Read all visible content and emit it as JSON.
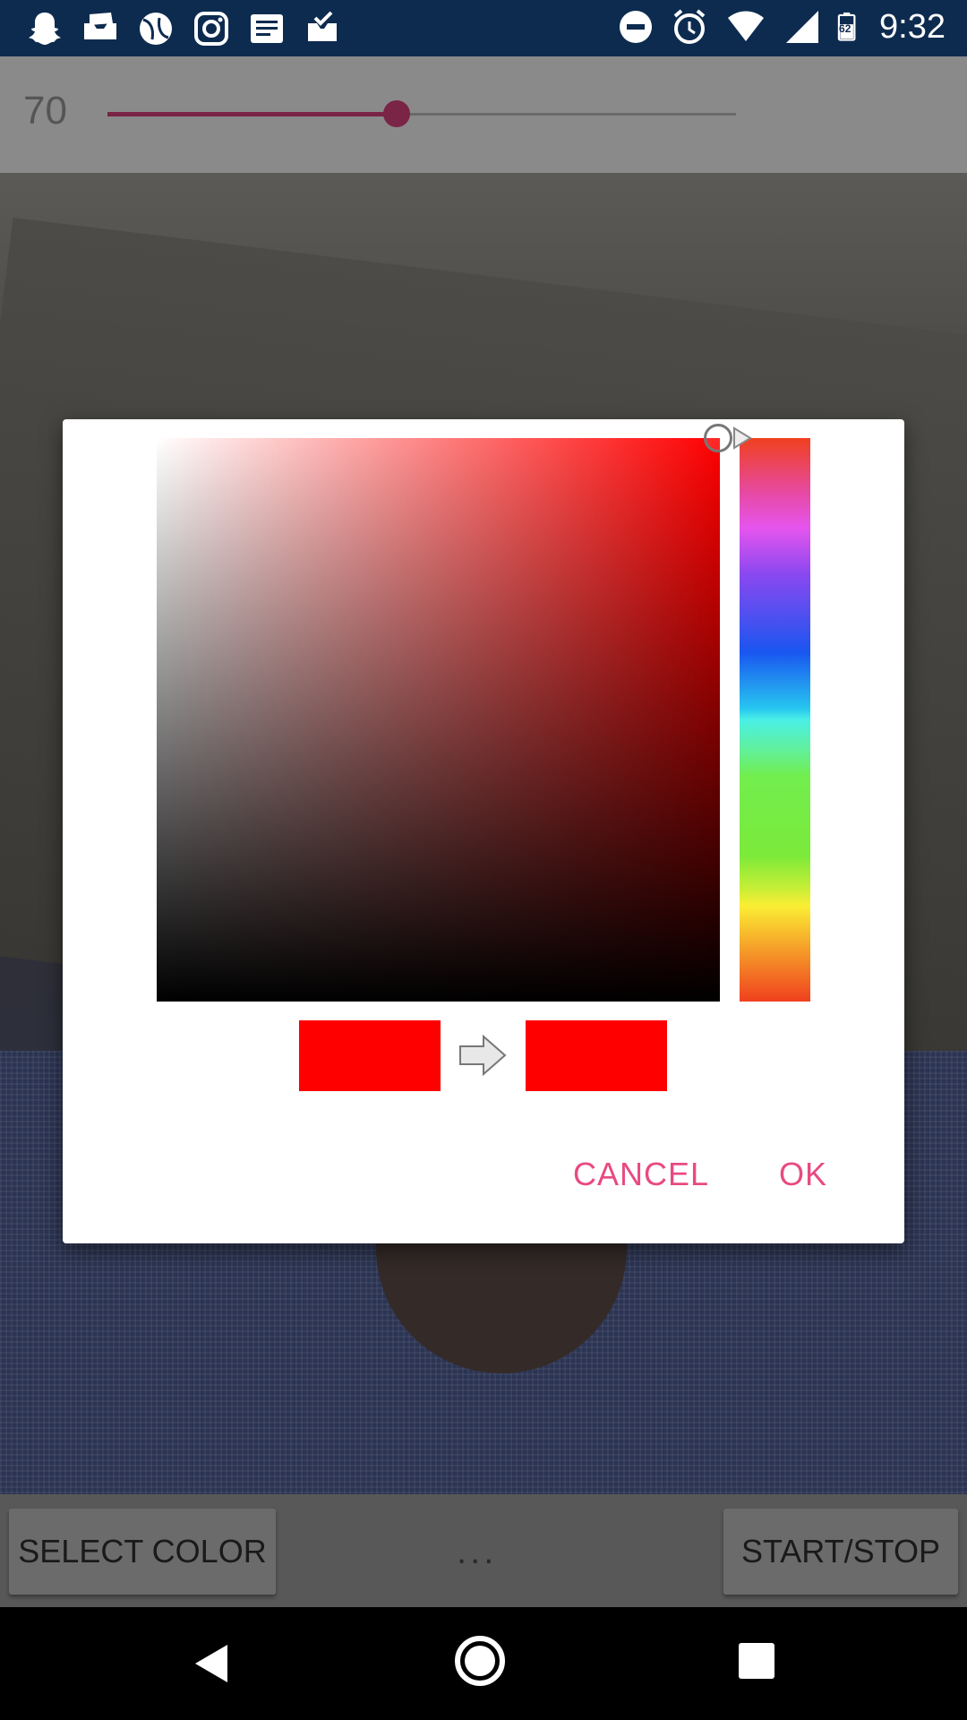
{
  "status_bar": {
    "time": "9:32",
    "battery_level": "62",
    "left_icons": [
      "snapchat-icon",
      "inbox-icon",
      "ball-icon",
      "instagram-icon",
      "news-icon",
      "clipboard-icon"
    ],
    "right_icons": [
      "do-not-disturb-icon",
      "alarm-icon",
      "wifi-icon",
      "signal-icon",
      "battery-icon"
    ]
  },
  "slider": {
    "value_label": "70",
    "value": 70,
    "max": 152,
    "accent_color": "#7a2446"
  },
  "dialog": {
    "hue_color": "#ff0000",
    "old_color": "#ff0000",
    "new_color": "#ff0000",
    "cancel_label": "CANCEL",
    "ok_label": "OK",
    "button_color": "#e84a82"
  },
  "bottom_bar": {
    "select_color_label": "SELECT COLOR",
    "start_stop_label": "START/STOP",
    "more_label": "..."
  }
}
